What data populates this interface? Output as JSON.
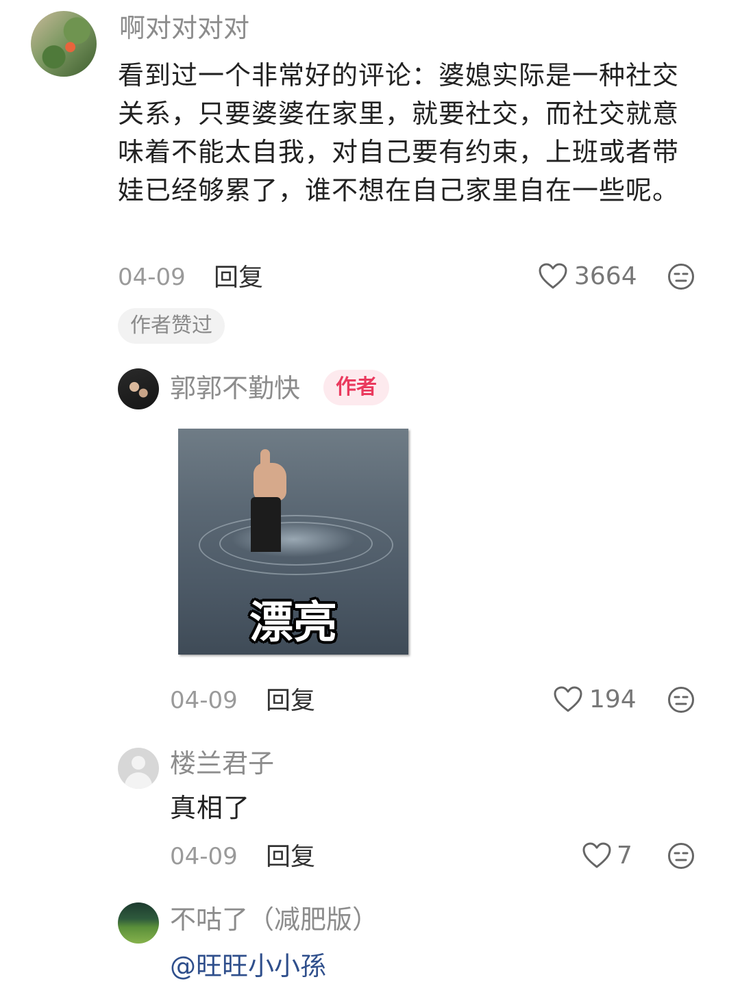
{
  "comments": [
    {
      "username": "啊对对对对",
      "text": "看到过一个非常好的评论：婆媳实际是一种社交关系，只要婆婆在家里，就要社交，而社交就意味着不能太自我，对自己要有约束，上班或者带娃已经够累了，谁不想在自己家里自在一些呢。",
      "date": "04-09",
      "reply_label": "回复",
      "likes": "3664",
      "liked_tag": "作者赞过"
    },
    {
      "username": "郭郭不勤快",
      "author_badge": "作者",
      "sticker_caption": "漂亮",
      "date": "04-09",
      "reply_label": "回复",
      "likes": "194"
    },
    {
      "username": "楼兰君子",
      "text": "真相了",
      "date": "04-09",
      "reply_label": "回复",
      "likes": "7"
    },
    {
      "username": "不咕了（减肥版）",
      "mention": "@旺旺小小孫"
    }
  ],
  "colors": {
    "author_badge_text": "#ea3a5e",
    "author_badge_bg": "#fdeaee",
    "mention": "#2f4f8c"
  },
  "icons": {
    "like": "heart-outline-icon",
    "dislike": "neutral-face-icon"
  }
}
